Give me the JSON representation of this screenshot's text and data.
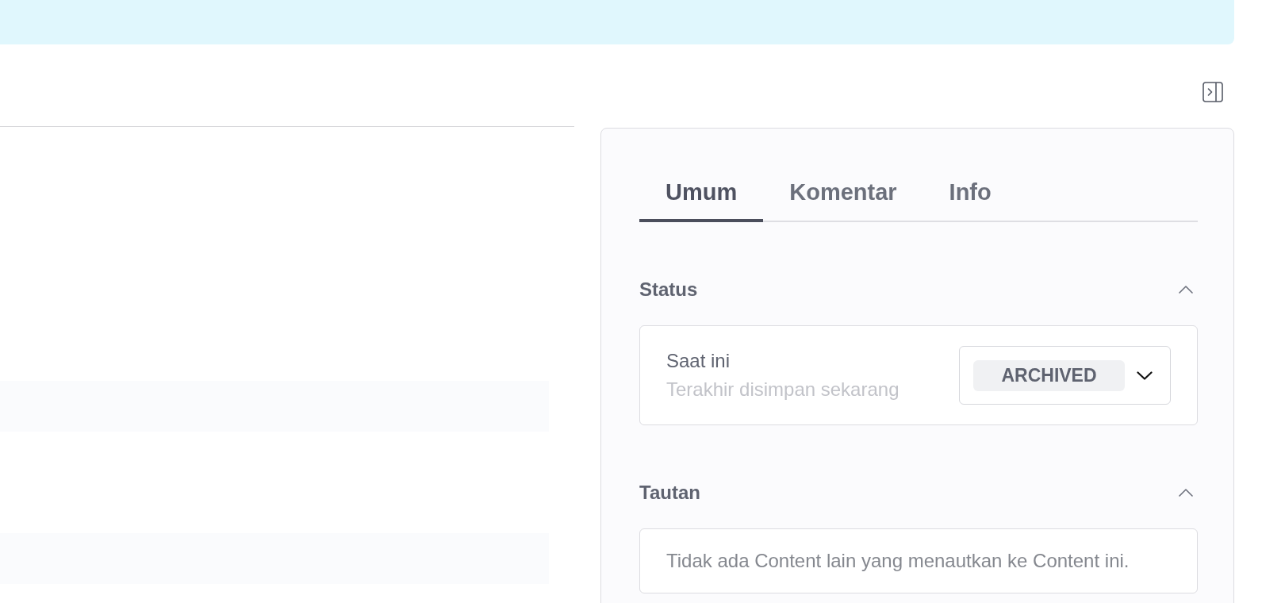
{
  "tabs": [
    {
      "label": "Umum",
      "selected": true
    },
    {
      "label": "Komentar",
      "selected": false
    },
    {
      "label": "Info",
      "selected": false
    }
  ],
  "sections": [
    {
      "kind": "status",
      "title": "Status",
      "expanded": true,
      "label": "Saat ini",
      "note": "Terakhir disimpan sekarang",
      "status": "ARCHIVED"
    },
    {
      "kind": "links",
      "title": "Tautan",
      "expanded": true,
      "message": "Tidak ada Content lain yang menautkan ke Content ini."
    }
  ]
}
